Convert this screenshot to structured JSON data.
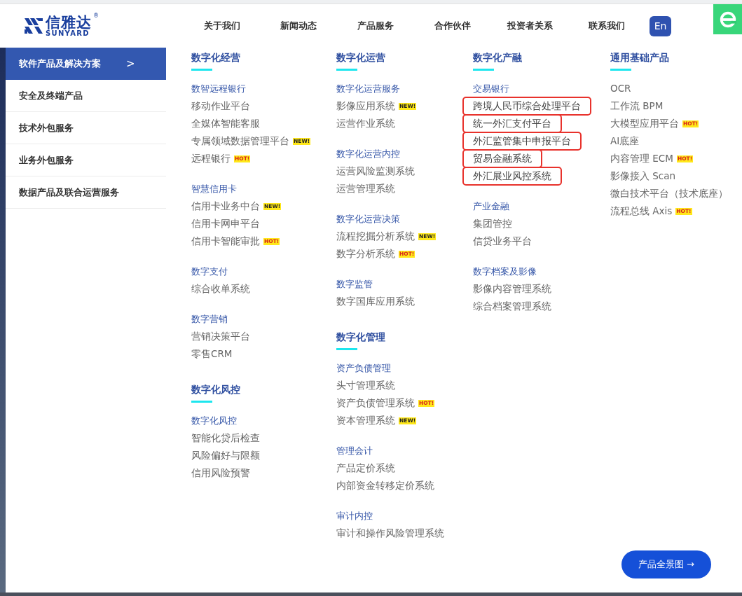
{
  "header": {
    "logo": {
      "name": "信雅达",
      "sub": "SUNYARD",
      "mark": "®"
    },
    "nav": [
      {
        "label": "关于我们"
      },
      {
        "label": "新闻动态"
      },
      {
        "label": "产品服务"
      },
      {
        "label": "合作伙伴"
      },
      {
        "label": "投资者关系"
      },
      {
        "label": "联系我们"
      }
    ],
    "language_button": "En"
  },
  "sidebar": {
    "items": [
      {
        "label": "软件产品及解决方案",
        "selected": true,
        "chevron": ">"
      },
      {
        "label": "安全及终端产品",
        "selected": false
      },
      {
        "label": "技术外包服务",
        "selected": false
      },
      {
        "label": "业务外包服务",
        "selected": false
      },
      {
        "label": "数据产品及联合运营服务",
        "selected": false
      }
    ]
  },
  "columns": [
    {
      "sections": [
        {
          "title": "数字化经营",
          "groups": [
            {
              "title": "数智远程银行",
              "items": [
                {
                  "label": "移动作业平台"
                },
                {
                  "label": "全媒体智能客服"
                },
                {
                  "label": "专属领域数据管理平台",
                  "badge": {
                    "kind": "new",
                    "text": "NEW!"
                  }
                },
                {
                  "label": "远程银行",
                  "badge": {
                    "kind": "hot",
                    "text": "HOT!"
                  }
                }
              ]
            },
            {
              "title": "智慧信用卡",
              "items": [
                {
                  "label": "信用卡业务中台",
                  "badge": {
                    "kind": "new",
                    "text": "NEW!"
                  }
                },
                {
                  "label": "信用卡网申平台"
                },
                {
                  "label": "信用卡智能审批",
                  "badge": {
                    "kind": "hot",
                    "text": "HOT!"
                  }
                }
              ]
            },
            {
              "title": "数字支付",
              "items": [
                {
                  "label": "综合收单系统"
                }
              ]
            },
            {
              "title": "数字营销",
              "items": [
                {
                  "label": "营销决策平台"
                },
                {
                  "label": "零售CRM"
                }
              ]
            }
          ]
        },
        {
          "title": "数字化风控",
          "groups": [
            {
              "title": "数字化风控",
              "items": [
                {
                  "label": "智能化贷后检查"
                },
                {
                  "label": "风险偏好与限额"
                },
                {
                  "label": "信用风险预警"
                }
              ]
            }
          ]
        }
      ]
    },
    {
      "sections": [
        {
          "title": "数字化运营",
          "groups": [
            {
              "title": "数字化运营服务",
              "items": [
                {
                  "label": "影像应用系统",
                  "badge": {
                    "kind": "new",
                    "text": "NEW!"
                  }
                },
                {
                  "label": "运营作业系统"
                }
              ]
            },
            {
              "title": "数字化运营内控",
              "items": [
                {
                  "label": "运营风险监测系统"
                },
                {
                  "label": "运营管理系统"
                }
              ]
            },
            {
              "title": "数字化运营决策",
              "items": [
                {
                  "label": "流程挖掘分析系统",
                  "badge": {
                    "kind": "new",
                    "text": "NEW!"
                  }
                },
                {
                  "label": "数字分析系统",
                  "badge": {
                    "kind": "hot",
                    "text": "HOT!"
                  }
                }
              ]
            },
            {
              "title": "数字监管",
              "items": [
                {
                  "label": "数字国库应用系统"
                }
              ]
            }
          ]
        },
        {
          "title": "数字化管理",
          "groups": [
            {
              "title": "资产负债管理",
              "items": [
                {
                  "label": "头寸管理系统"
                },
                {
                  "label": "资产负债管理系统",
                  "badge": {
                    "kind": "hot",
                    "text": "HOT!"
                  }
                },
                {
                  "label": "资本管理系统",
                  "badge": {
                    "kind": "new",
                    "text": "NEW!"
                  }
                }
              ]
            },
            {
              "title": "管理会计",
              "items": [
                {
                  "label": "产品定价系统"
                },
                {
                  "label": "内部资金转移定价系统"
                }
              ]
            },
            {
              "title": "审计内控",
              "items": [
                {
                  "label": "审计和操作风险管理系统"
                }
              ]
            }
          ]
        }
      ]
    },
    {
      "sections": [
        {
          "title": "数字化产融",
          "groups": [
            {
              "title": "交易银行",
              "items": [
                {
                  "label": "跨境人民币综合处理平台",
                  "highlighted": true
                },
                {
                  "label": "统一外汇支付平台",
                  "highlighted": true
                },
                {
                  "label": "外汇监管集中申报平台",
                  "highlighted": true
                },
                {
                  "label": "贸易金融系统",
                  "highlighted": true
                },
                {
                  "label": "外汇展业风控系统",
                  "highlighted": true
                }
              ]
            },
            {
              "title": "产业金融",
              "items": [
                {
                  "label": "集团管控"
                },
                {
                  "label": "信贷业务平台"
                }
              ]
            },
            {
              "title": "数字档案及影像",
              "items": [
                {
                  "label": "影像内容管理系统"
                },
                {
                  "label": "综合档案管理系统"
                }
              ]
            }
          ]
        }
      ]
    },
    {
      "sections": [
        {
          "title": "通用基础产品",
          "groups": [
            {
              "items": [
                {
                  "label": "OCR"
                },
                {
                  "label": "工作流 BPM"
                },
                {
                  "label": "大模型应用平台",
                  "badge": {
                    "kind": "hot",
                    "text": "HOT!"
                  }
                },
                {
                  "label": "AI底座"
                },
                {
                  "label": "内容管理 ECM",
                  "badge": {
                    "kind": "hot",
                    "text": "HOT!"
                  }
                },
                {
                  "label": "影像接入 Scan"
                },
                {
                  "label": "微白技术平台（技术底座）"
                },
                {
                  "label": "流程总线 Axis",
                  "badge": {
                    "kind": "hot",
                    "text": "HOT!"
                  }
                }
              ]
            }
          ]
        }
      ]
    }
  ],
  "overview_button": "产品全景图 →"
}
